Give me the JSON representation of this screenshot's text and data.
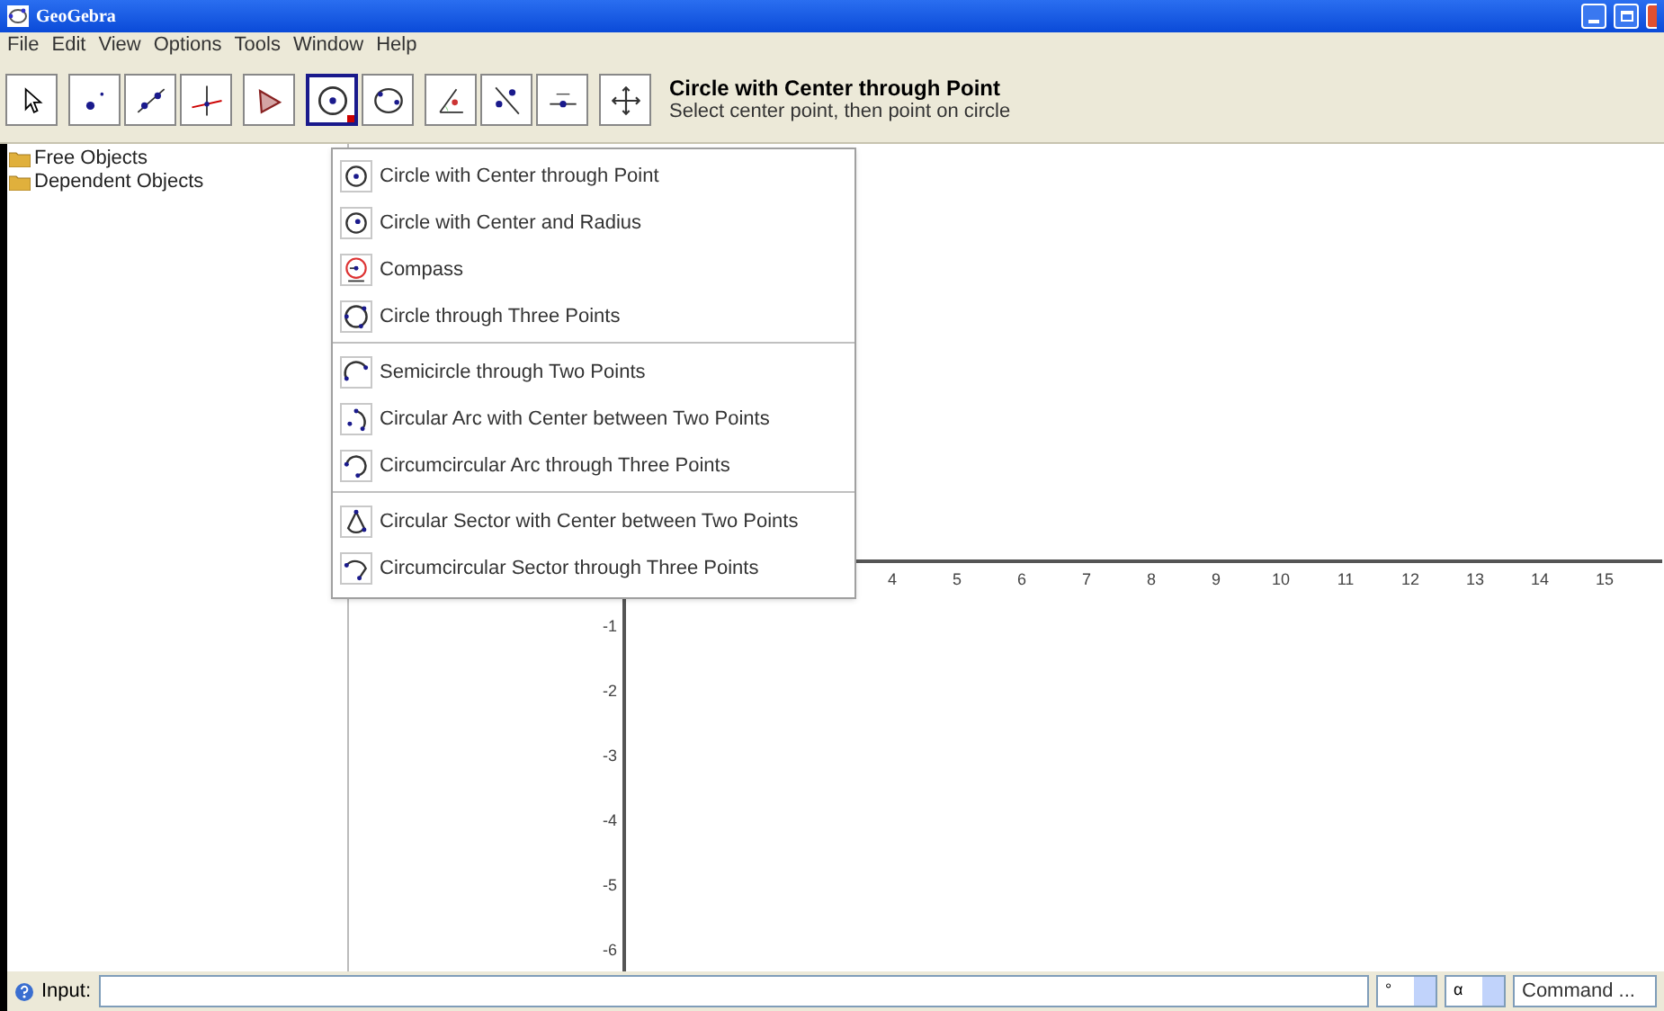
{
  "window": {
    "title": "GeoGebra"
  },
  "menu": [
    "File",
    "Edit",
    "View",
    "Options",
    "Tools",
    "Window",
    "Help"
  ],
  "toolbar": {
    "groups": [
      [
        {
          "kind": "pointer",
          "selected": false
        }
      ],
      [
        {
          "kind": "point",
          "selected": false
        },
        {
          "kind": "line",
          "selected": false
        },
        {
          "kind": "perpendicular",
          "selected": false
        }
      ],
      [
        {
          "kind": "polygon",
          "selected": false
        }
      ],
      [
        {
          "kind": "circle",
          "selected": true
        },
        {
          "kind": "conic",
          "selected": false
        }
      ],
      [
        {
          "kind": "angle",
          "selected": false
        },
        {
          "kind": "reflect",
          "selected": false
        },
        {
          "kind": "slider",
          "selected": false
        }
      ],
      [
        {
          "kind": "move",
          "selected": false
        }
      ]
    ],
    "tool_title": "Circle with Center through Point",
    "tool_help": "Select center point, then point on circle"
  },
  "algebra": {
    "folders": [
      "Free Objects",
      "Dependent Objects"
    ]
  },
  "tool_menu": [
    [
      {
        "label": "Circle with Center through Point",
        "kind": "circle_point"
      },
      {
        "label": "Circle with Center and Radius",
        "kind": "circle_radius"
      },
      {
        "label": "Compass",
        "kind": "compass"
      },
      {
        "label": "Circle through Three Points",
        "kind": "circle3"
      }
    ],
    [
      {
        "label": "Semicircle through Two Points",
        "kind": "semicircle"
      },
      {
        "label": "Circular Arc with Center between Two Points",
        "kind": "arc"
      },
      {
        "label": "Circumcircular Arc through Three Points",
        "kind": "arc3"
      }
    ],
    [
      {
        "label": "Circular Sector with Center between Two Points",
        "kind": "sector"
      },
      {
        "label": "Circumcircular Sector through Three Points",
        "kind": "sector3"
      }
    ]
  ],
  "graphics": {
    "x_ticks": [
      "4",
      "5",
      "6",
      "7",
      "8",
      "9",
      "10",
      "11",
      "12",
      "13",
      "14",
      "15"
    ],
    "y_ticks": [
      "-1",
      "-2",
      "-3",
      "-4",
      "-5",
      "-6"
    ]
  },
  "input_bar": {
    "label": "Input:",
    "symbol": "°",
    "greek": "α",
    "command": "Command ..."
  }
}
